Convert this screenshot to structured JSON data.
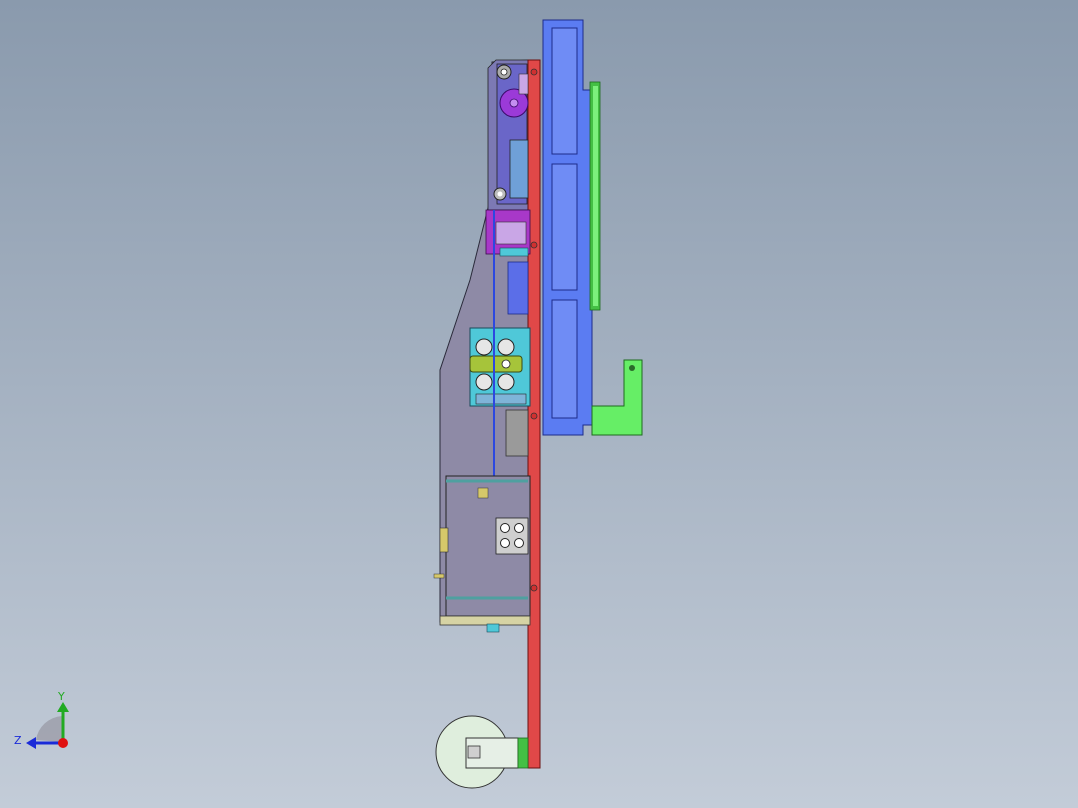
{
  "viewport": {
    "background_top": "#8a9aad",
    "background_bottom": "#c3ccd8"
  },
  "triad": {
    "y_label": "Y",
    "z_label": "Z",
    "y_color": "#22aa22",
    "z_color": "#1a2bd8",
    "x_color": "#e01010"
  },
  "parts": {
    "main_plate_color": "#e04848",
    "frame_color": "#5b7cf2",
    "rail_color": "#5de85d",
    "bracket_color": "#66ee66",
    "gear_color": "#9b3ad8",
    "housing_color": "#8c88aa",
    "roller_block_color": "#4fc8d8",
    "lever_color": "#a6c43a",
    "base_color": "#d6d3a4",
    "wheel_color": "#dfeedd"
  }
}
